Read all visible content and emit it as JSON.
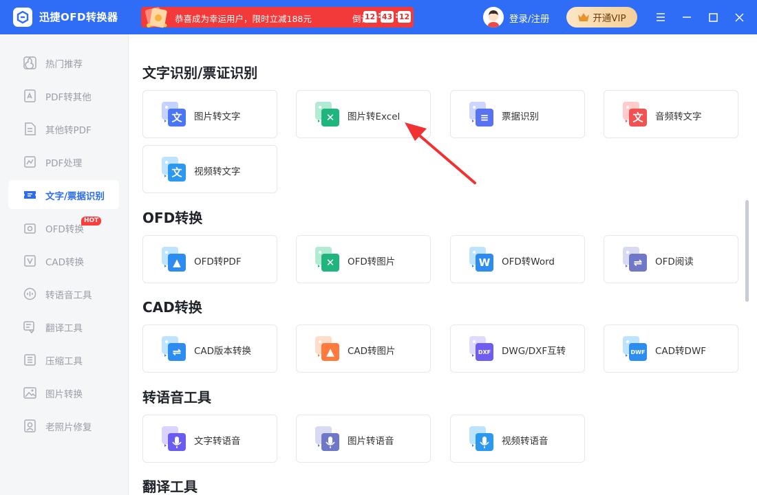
{
  "app": {
    "title": "迅捷OFD转换器",
    "logo_icon": "app-logo-icon"
  },
  "promo": {
    "text": "恭喜成为幸运用户，限时立减188元",
    "countdown_label": "倒计时",
    "countdown": [
      "12",
      "43",
      "12"
    ],
    "color": "#f23a3a"
  },
  "header": {
    "login_label": "登录/注册",
    "vip_label": "开通VIP",
    "accent": "#2f6df6"
  },
  "sidebar": {
    "items": [
      {
        "label": "热门推荐",
        "icon": "hot-recommend-icon",
        "active": false
      },
      {
        "label": "PDF转其他",
        "icon": "pdf-convert-icon",
        "active": false
      },
      {
        "label": "其他转PDF",
        "icon": "to-pdf-icon",
        "active": false
      },
      {
        "label": "PDF处理",
        "icon": "pdf-process-icon",
        "active": false
      },
      {
        "label": "文字/票据识别",
        "icon": "ocr-ticket-icon",
        "active": true
      },
      {
        "label": "OFD转换",
        "icon": "ofd-convert-icon",
        "active": false,
        "badge": "HOT"
      },
      {
        "label": "CAD转换",
        "icon": "cad-convert-icon",
        "active": false
      },
      {
        "label": "转语音工具",
        "icon": "voice-icon",
        "active": false
      },
      {
        "label": "翻译工具",
        "icon": "translate-icon",
        "active": false
      },
      {
        "label": "压缩工具",
        "icon": "compress-icon",
        "active": false
      },
      {
        "label": "图片转换",
        "icon": "image-convert-icon",
        "active": false
      },
      {
        "label": "老照片修复",
        "icon": "photo-restore-icon",
        "active": false
      }
    ]
  },
  "sections": [
    {
      "title": "文字识别/票证识别",
      "cards": [
        {
          "label": "图片转文字",
          "icon": "image-to-text-icon"
        },
        {
          "label": "图片转Excel",
          "icon": "image-to-excel-icon"
        },
        {
          "label": "票据识别",
          "icon": "ticket-recognition-icon"
        },
        {
          "label": "音频转文字",
          "icon": "audio-to-text-icon"
        },
        {
          "label": "视频转文字",
          "icon": "video-to-text-icon"
        }
      ]
    },
    {
      "title": "OFD转换",
      "cards": [
        {
          "label": "OFD转PDF",
          "icon": "ofd-to-pdf-icon"
        },
        {
          "label": "OFD转图片",
          "icon": "ofd-to-image-icon"
        },
        {
          "label": "OFD转Word",
          "icon": "ofd-to-word-icon"
        },
        {
          "label": "OFD阅读",
          "icon": "ofd-reader-icon"
        }
      ]
    },
    {
      "title": "CAD转换",
      "cards": [
        {
          "label": "CAD版本转换",
          "icon": "cad-version-icon"
        },
        {
          "label": "CAD转图片",
          "icon": "cad-to-image-icon"
        },
        {
          "label": "DWG/DXF互转",
          "icon": "dwg-dxf-icon"
        },
        {
          "label": "CAD转DWF",
          "icon": "cad-to-dwf-icon"
        }
      ]
    },
    {
      "title": "转语音工具",
      "cards": [
        {
          "label": "文字转语音",
          "icon": "text-to-speech-icon"
        },
        {
          "label": "图片转语音",
          "icon": "image-to-speech-icon"
        },
        {
          "label": "视频转语音",
          "icon": "video-to-speech-icon"
        }
      ]
    },
    {
      "title": "翻译工具",
      "cards": []
    }
  ]
}
